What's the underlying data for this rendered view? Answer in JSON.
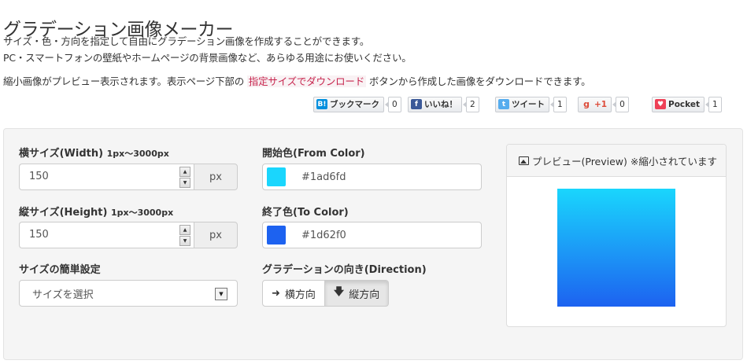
{
  "page": {
    "title": "グラデーション画像メーカー",
    "desc1": "サイズ・色・方向を指定して自由にグラデーション画像を作成することができます。",
    "desc2": "PC・スマートフォンの壁紙やホームページの背景画像など、あらゆる用途にお使いください。",
    "desc3_pre": "縮小画像がプレビュー表示されます。表示ページ下部の",
    "desc3_link": "指定サイズでダウンロード",
    "desc3_post": "ボタンから作成した画像をダウンロードできます。"
  },
  "social": {
    "hatena": {
      "icon": "B!",
      "label": "ブックマーク",
      "count": "0"
    },
    "facebook": {
      "icon": "f",
      "label": "いいね！",
      "count": "2"
    },
    "twitter": {
      "icon": "t",
      "label": "ツイート",
      "count": "1"
    },
    "gplus": {
      "icon": "g",
      "label": "+1",
      "count": "0"
    },
    "pocket": {
      "icon": "♥",
      "label": "Pocket",
      "count": "1"
    }
  },
  "form": {
    "width_label": "横サイズ(Width)",
    "width_hint": "1px〜3000px",
    "width_value": "150",
    "height_label": "縦サイズ(Height)",
    "height_hint": "1px〜3000px",
    "height_value": "150",
    "unit": "px",
    "preset_label": "サイズの簡単設定",
    "preset_selected": "サイズを選択",
    "from_label": "開始色(From Color)",
    "from_value": "#1ad6fd",
    "to_label": "終了色(To Color)",
    "to_value": "#1d62f0",
    "direction_label": "グラデーションの向き(Direction)",
    "dir_horizontal": "横方向",
    "dir_vertical": "縦方向"
  },
  "preview": {
    "title": "プレビュー(Preview) ※縮小されています"
  },
  "colors": {
    "from": "#1ad6fd",
    "to": "#1d62f0",
    "hatena": "#008fde",
    "facebook": "#3b5998",
    "twitter": "#55acee",
    "gplus": "#dd4b39",
    "pocket": "#ee4056"
  }
}
